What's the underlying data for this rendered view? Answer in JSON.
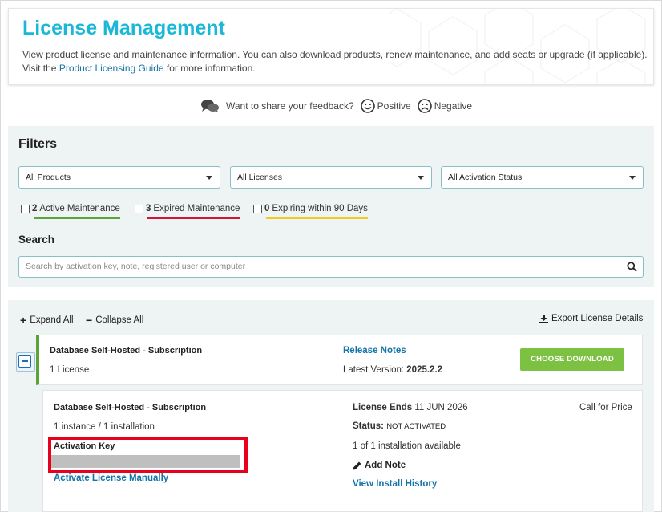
{
  "header": {
    "title": "License Management",
    "description_before": "View product license and maintenance information. You can also download products, renew maintenance, and add seats or upgrade (if applicable). Visit the ",
    "guide_link": "Product Licensing Guide",
    "description_after": " for more information."
  },
  "feedback": {
    "prompt": "Want to share your feedback?",
    "positive": "Positive",
    "negative": "Negative"
  },
  "filters": {
    "title": "Filters",
    "selects": [
      "All Products",
      "All Licenses",
      "All Activation Status"
    ],
    "checks": [
      {
        "count": "2",
        "label": "Active Maintenance",
        "color": "#5aa53a"
      },
      {
        "count": "3",
        "label": "Expired Maintenance",
        "color": "#d1143b"
      },
      {
        "count": "0",
        "label": "Expiring within 90 Days",
        "color": "#f2cc1f"
      }
    ]
  },
  "search": {
    "title": "Search",
    "placeholder": "Search by activation key, note, registered user or computer"
  },
  "toolbar": {
    "expand_all": "Expand All",
    "collapse_all": "Collapse All",
    "export": "Export License Details"
  },
  "product": {
    "name": "Database Self-Hosted - Subscription",
    "license_count": "1 License",
    "release_notes": "Release Notes",
    "latest_version_label": "Latest Version:",
    "latest_version": "2025.2.2",
    "choose_download": "CHOOSE DOWNLOAD"
  },
  "license": {
    "name": "Database Self-Hosted - Subscription",
    "instances": "1 instance / 1 installation",
    "activation_key_label": "Activation Key",
    "activate_manually": "Activate License Manually",
    "ends_label": "License Ends",
    "ends_date": "11 JUN 2026",
    "status_label": "Status:",
    "status_value": "NOT ACTIVATED",
    "installations": "1 of 1 installation available",
    "add_note": "Add Note",
    "install_history": "View Install History",
    "price": "Call for Price"
  },
  "colors": {
    "accent": "#1ab8d6",
    "link": "#1474a8",
    "download": "#7dc143",
    "highlight": "#e8001c"
  }
}
